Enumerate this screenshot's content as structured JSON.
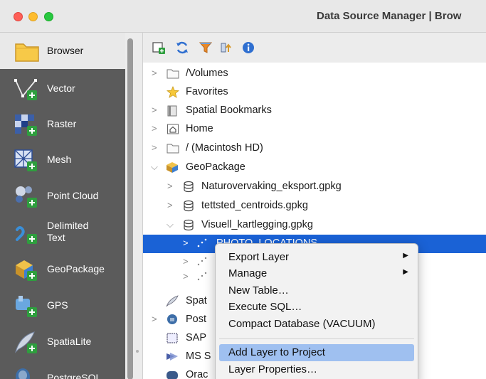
{
  "window": {
    "title": "Data Source Manager | Brow"
  },
  "sidebar": {
    "items": [
      {
        "label": "Browser",
        "icon": "folder-icon"
      },
      {
        "label": "Vector",
        "icon": "vector-icon"
      },
      {
        "label": "Raster",
        "icon": "raster-icon"
      },
      {
        "label": "Mesh",
        "icon": "mesh-icon"
      },
      {
        "label": "Point Cloud",
        "icon": "point-cloud-icon"
      },
      {
        "label": "Delimited\nText",
        "line1": "Delimited",
        "line2": "Text",
        "icon": "delimited-text-icon"
      },
      {
        "label": "GeoPackage",
        "icon": "geopackage-icon"
      },
      {
        "label": "GPS",
        "icon": "gps-icon"
      },
      {
        "label": "SpatiaLite",
        "icon": "spatialite-icon"
      },
      {
        "label": "PostgreSQL",
        "icon": "postgresql-icon"
      }
    ]
  },
  "toolbar": {
    "icons": [
      "add-selected-icon",
      "refresh-icon",
      "filter-icon",
      "collapse-icon",
      "info-icon"
    ]
  },
  "tree": [
    {
      "label": "/Volumes",
      "icon": "folder-icon",
      "level": 0,
      "expander": ">"
    },
    {
      "label": "Favorites",
      "icon": "star-icon",
      "level": 0,
      "expander": ""
    },
    {
      "label": "Spatial Bookmarks",
      "icon": "bookmark-icon",
      "level": 0,
      "expander": ">"
    },
    {
      "label": "Home",
      "icon": "home-icon",
      "level": 0,
      "expander": ">"
    },
    {
      "label": "/ (Macintosh HD)",
      "icon": "folder-icon",
      "level": 0,
      "expander": ">"
    },
    {
      "label": "GeoPackage",
      "icon": "geopackage-icon",
      "level": 0,
      "expander": "v"
    },
    {
      "label": "Naturovervaking_eksport.gpkg",
      "icon": "database-icon",
      "level": 1,
      "expander": ">"
    },
    {
      "label": "tettsted_centroids.gpkg",
      "icon": "database-icon",
      "level": 1,
      "expander": ">"
    },
    {
      "label": "Visuell_kartlegging.gpkg",
      "icon": "database-icon",
      "level": 1,
      "expander": "v"
    },
    {
      "label": "PHOTO_LOCATIONS",
      "icon": "point-layer-icon",
      "level": 2,
      "expander": ">"
    },
    {
      "label": "",
      "icon": "point-layer-icon",
      "level": 2,
      "expander": ">"
    },
    {
      "label": "",
      "icon": "point-layer-icon",
      "level": 2,
      "expander": ">"
    },
    {
      "label": "Spat",
      "icon": "feather-icon",
      "level": 0,
      "expander": ""
    },
    {
      "label": "Post",
      "icon": "elephant-icon",
      "level": 0,
      "expander": ">"
    },
    {
      "label": "SAP",
      "icon": "sap-icon",
      "level": 0,
      "expander": ""
    },
    {
      "label": "MS S",
      "icon": "mssql-icon",
      "level": 0,
      "expander": ""
    },
    {
      "label": "Orac",
      "icon": "oracle-icon",
      "level": 0,
      "expander": ""
    }
  ],
  "context_menu": {
    "items": [
      {
        "label": "Export Layer",
        "submenu": true
      },
      {
        "label": "Manage",
        "submenu": true
      },
      {
        "label": "New Table…",
        "submenu": false
      },
      {
        "label": "Execute SQL…",
        "submenu": false
      },
      {
        "label": "Compact Database (VACUUM)",
        "submenu": false
      },
      {
        "label": "Add Layer to Project",
        "submenu": false,
        "highlighted": true
      },
      {
        "label": "Layer Properties…",
        "submenu": false
      }
    ],
    "submenu_glyph": "▶"
  },
  "colors": {
    "selection": "#1a62d6",
    "menu_highlight": "#9fc0f0",
    "sidebar_bg": "#5b5b5b",
    "plus_badge": "#2e9e3e"
  }
}
